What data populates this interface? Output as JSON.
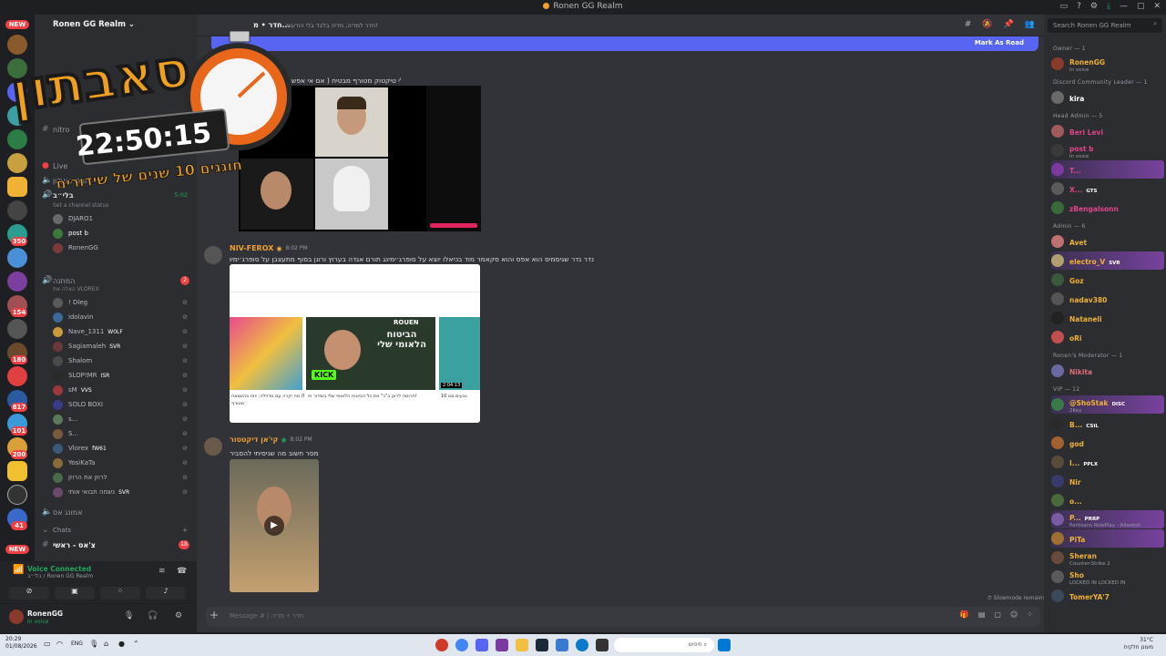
{
  "window": {
    "title": "Ronen GG Realm"
  },
  "rail": {
    "new_badge_top": "NEW",
    "new_badge_bottom": "NEW",
    "badges": [
      "350",
      "154",
      "180",
      "817",
      "101",
      "200",
      "41"
    ]
  },
  "server": {
    "name": "Ronen GG Realm"
  },
  "channels": {
    "top_partial": "nitro",
    "live": "Live",
    "members_club": "חברי מועדון",
    "biliv": "בלי״ב",
    "biliv_time": "5:02",
    "set_status": "Set a channel status",
    "voice_users": [
      {
        "name": "DJARO1",
        "tag": ""
      },
      {
        "name": "post b",
        "tag": ""
      },
      {
        "name": "RonenGG",
        "tag": ""
      }
    ],
    "waiting": "המתנה",
    "waiting_badge": "2",
    "waiting_sub": "הצלה את VLOREX",
    "waiting_users": [
      {
        "name": "! Dleg",
        "tag": ""
      },
      {
        "name": "idolavin",
        "tag": ""
      },
      {
        "name": "Nave_1311",
        "tag": "W0LF"
      },
      {
        "name": "Sagiamaleh",
        "tag": "SVR"
      },
      {
        "name": "Shalom",
        "tag": ""
      },
      {
        "name": "SLOP!MR",
        "tag": "ISR"
      },
      {
        "name": "sM",
        "tag": "VVS"
      },
      {
        "name": "SOLO BOXI",
        "tag": ""
      },
      {
        "name": "s...",
        "tag": ""
      },
      {
        "name": "S...",
        "tag": ""
      },
      {
        "name": "Vlorex",
        "tag": "fW61"
      },
      {
        "name": "YosiKaTa",
        "tag": ""
      },
      {
        "name": "לרוזן את הרוזן",
        "tag": ""
      },
      {
        "name": "נשמה תבואי אותי",
        "tag": "SVR"
      }
    ],
    "amunot": "אמונג אס",
    "chats_category": "Chats",
    "sas_rashi": "צ'אס - ראשי",
    "sas_badge": "18"
  },
  "voice_panel": {
    "status": "Voice Connected",
    "location": "בלי״ב / Ronen GG Realm"
  },
  "user_panel": {
    "name": "RonenGG",
    "status": "In voice"
  },
  "chat": {
    "channel_name": "חדר • מ...",
    "topic": "חדר למדיה, מדיה בלבד בלי הודעות!",
    "new_messages_action": "Mark As Read",
    "first_caption": "יצא לי טיקטוק מטורף מבטיח ( אם אי אפש",
    "messages": [
      {
        "author": "NIV-FEROX",
        "time": "8:02 PM",
        "text": "נדר נדר שגיסמיס הוא אפס והוא סקאמר מוד בכיאלו יוצא על סופרג׳ימינג תורם אגדה בערוץ ורונן בסוף מתעצבן על סופרג׳ימינג",
        "video_title_1": "ROUEN",
        "video_title_2": "הביטוח הלאומי שלי",
        "video_duration": "2:04:13",
        "kick_label": "KICK",
        "card_line_1": "מה יקרה עם גודזילה: יוזה בהשוואה (N",
        "card_line_2": "מטורף",
        "card_line_3": "תרומה לרונן ב\"כ\" את כל הביטוח הלאומי שלי בשידור חי!",
        "card_line_4": "10 גבעים מט"
      },
      {
        "author": "קי'אן דיקטטור",
        "time": "8:02 PM",
        "text": "מסר חשוב מה שניסיתי להסביר"
      }
    ],
    "slowmode": "Slowmode remains",
    "input_placeholder": "Message # | חדר • מדיה"
  },
  "overlay": {
    "title": "סאבתון",
    "timer": "22:50:15",
    "subtitle": "חוגגים 10 שנים של שידורים"
  },
  "members": {
    "search_placeholder": "Search Ronen GG Realm",
    "groups": [
      {
        "label": "Owner — 1",
        "members": [
          {
            "name": "RonenGG",
            "sub": "In voice",
            "color": "#f0b232"
          }
        ]
      },
      {
        "label": "Discord Community Leader — 1",
        "members": [
          {
            "name": "kira",
            "sub": "",
            "color": "#ffffff"
          }
        ]
      },
      {
        "label": "Head Admin — 5",
        "members": [
          {
            "name": "Beri Levi",
            "sub": "",
            "color": "#e0458a"
          },
          {
            "name": "post b",
            "sub": "In voice",
            "color": "#e0458a"
          },
          {
            "name": "T...",
            "sub": "",
            "color": "#e0458a"
          },
          {
            "name": "X...",
            "sub": "",
            "color": "#e0458a",
            "tag": "GTS"
          },
          {
            "name": "zBengalsonn",
            "sub": "",
            "color": "#e0458a"
          }
        ]
      },
      {
        "label": "Admin — 6",
        "members": [
          {
            "name": "Avet",
            "sub": "",
            "color": "#f0b232"
          },
          {
            "name": "electro_V",
            "sub": "",
            "color": "#f0b232",
            "tag": "SVR"
          },
          {
            "name": "Goz",
            "sub": "",
            "color": "#f0b232"
          },
          {
            "name": "nadav380",
            "sub": "",
            "color": "#f0b232"
          },
          {
            "name": "Nataneli",
            "sub": "",
            "color": "#f0b232"
          },
          {
            "name": "oRi",
            "sub": "",
            "color": "#f0b232"
          }
        ]
      },
      {
        "label": "Ronen's Moderator — 1",
        "members": [
          {
            "name": "Nikita",
            "sub": "",
            "color": "#e06c75"
          }
        ]
      },
      {
        "label": "VIP — 12",
        "members": [
          {
            "name": "@ShoStak",
            "sub": "2Key",
            "color": "#f0b232",
            "tag": "DISC"
          },
          {
            "name": "B...",
            "sub": "",
            "color": "#f0b232",
            "tag": "CSIL"
          },
          {
            "name": "god",
            "sub": "",
            "color": "#f0b232"
          },
          {
            "name": "I...",
            "sub": "",
            "color": "#f0b232",
            "tag": "PPLX"
          },
          {
            "name": "Nir",
            "sub": "",
            "color": "#f0b232"
          },
          {
            "name": "o...",
            "sub": "",
            "color": "#f0b232"
          },
          {
            "name": "P...",
            "sub": "Partisans RolePlay - Alleebot",
            "color": "#f0b232",
            "tag": "PRRP"
          },
          {
            "name": "PiTa",
            "sub": "",
            "color": "#f0b232"
          },
          {
            "name": "Sheran",
            "sub": "Counter-Strike 2",
            "color": "#f0b232"
          },
          {
            "name": "Sho",
            "sub": "LOCKED IN  LOCKED IN",
            "color": "#f0b232"
          },
          {
            "name": "TomerYA'7",
            "sub": "",
            "color": "#f0b232"
          }
        ]
      }
    ]
  },
  "taskbar": {
    "time": "20:29",
    "date": "01/08/2026",
    "lang": "ENG",
    "search_text": "חיפוש",
    "weather_temp": "31°C",
    "weather_desc": "מעונן חלקית"
  }
}
